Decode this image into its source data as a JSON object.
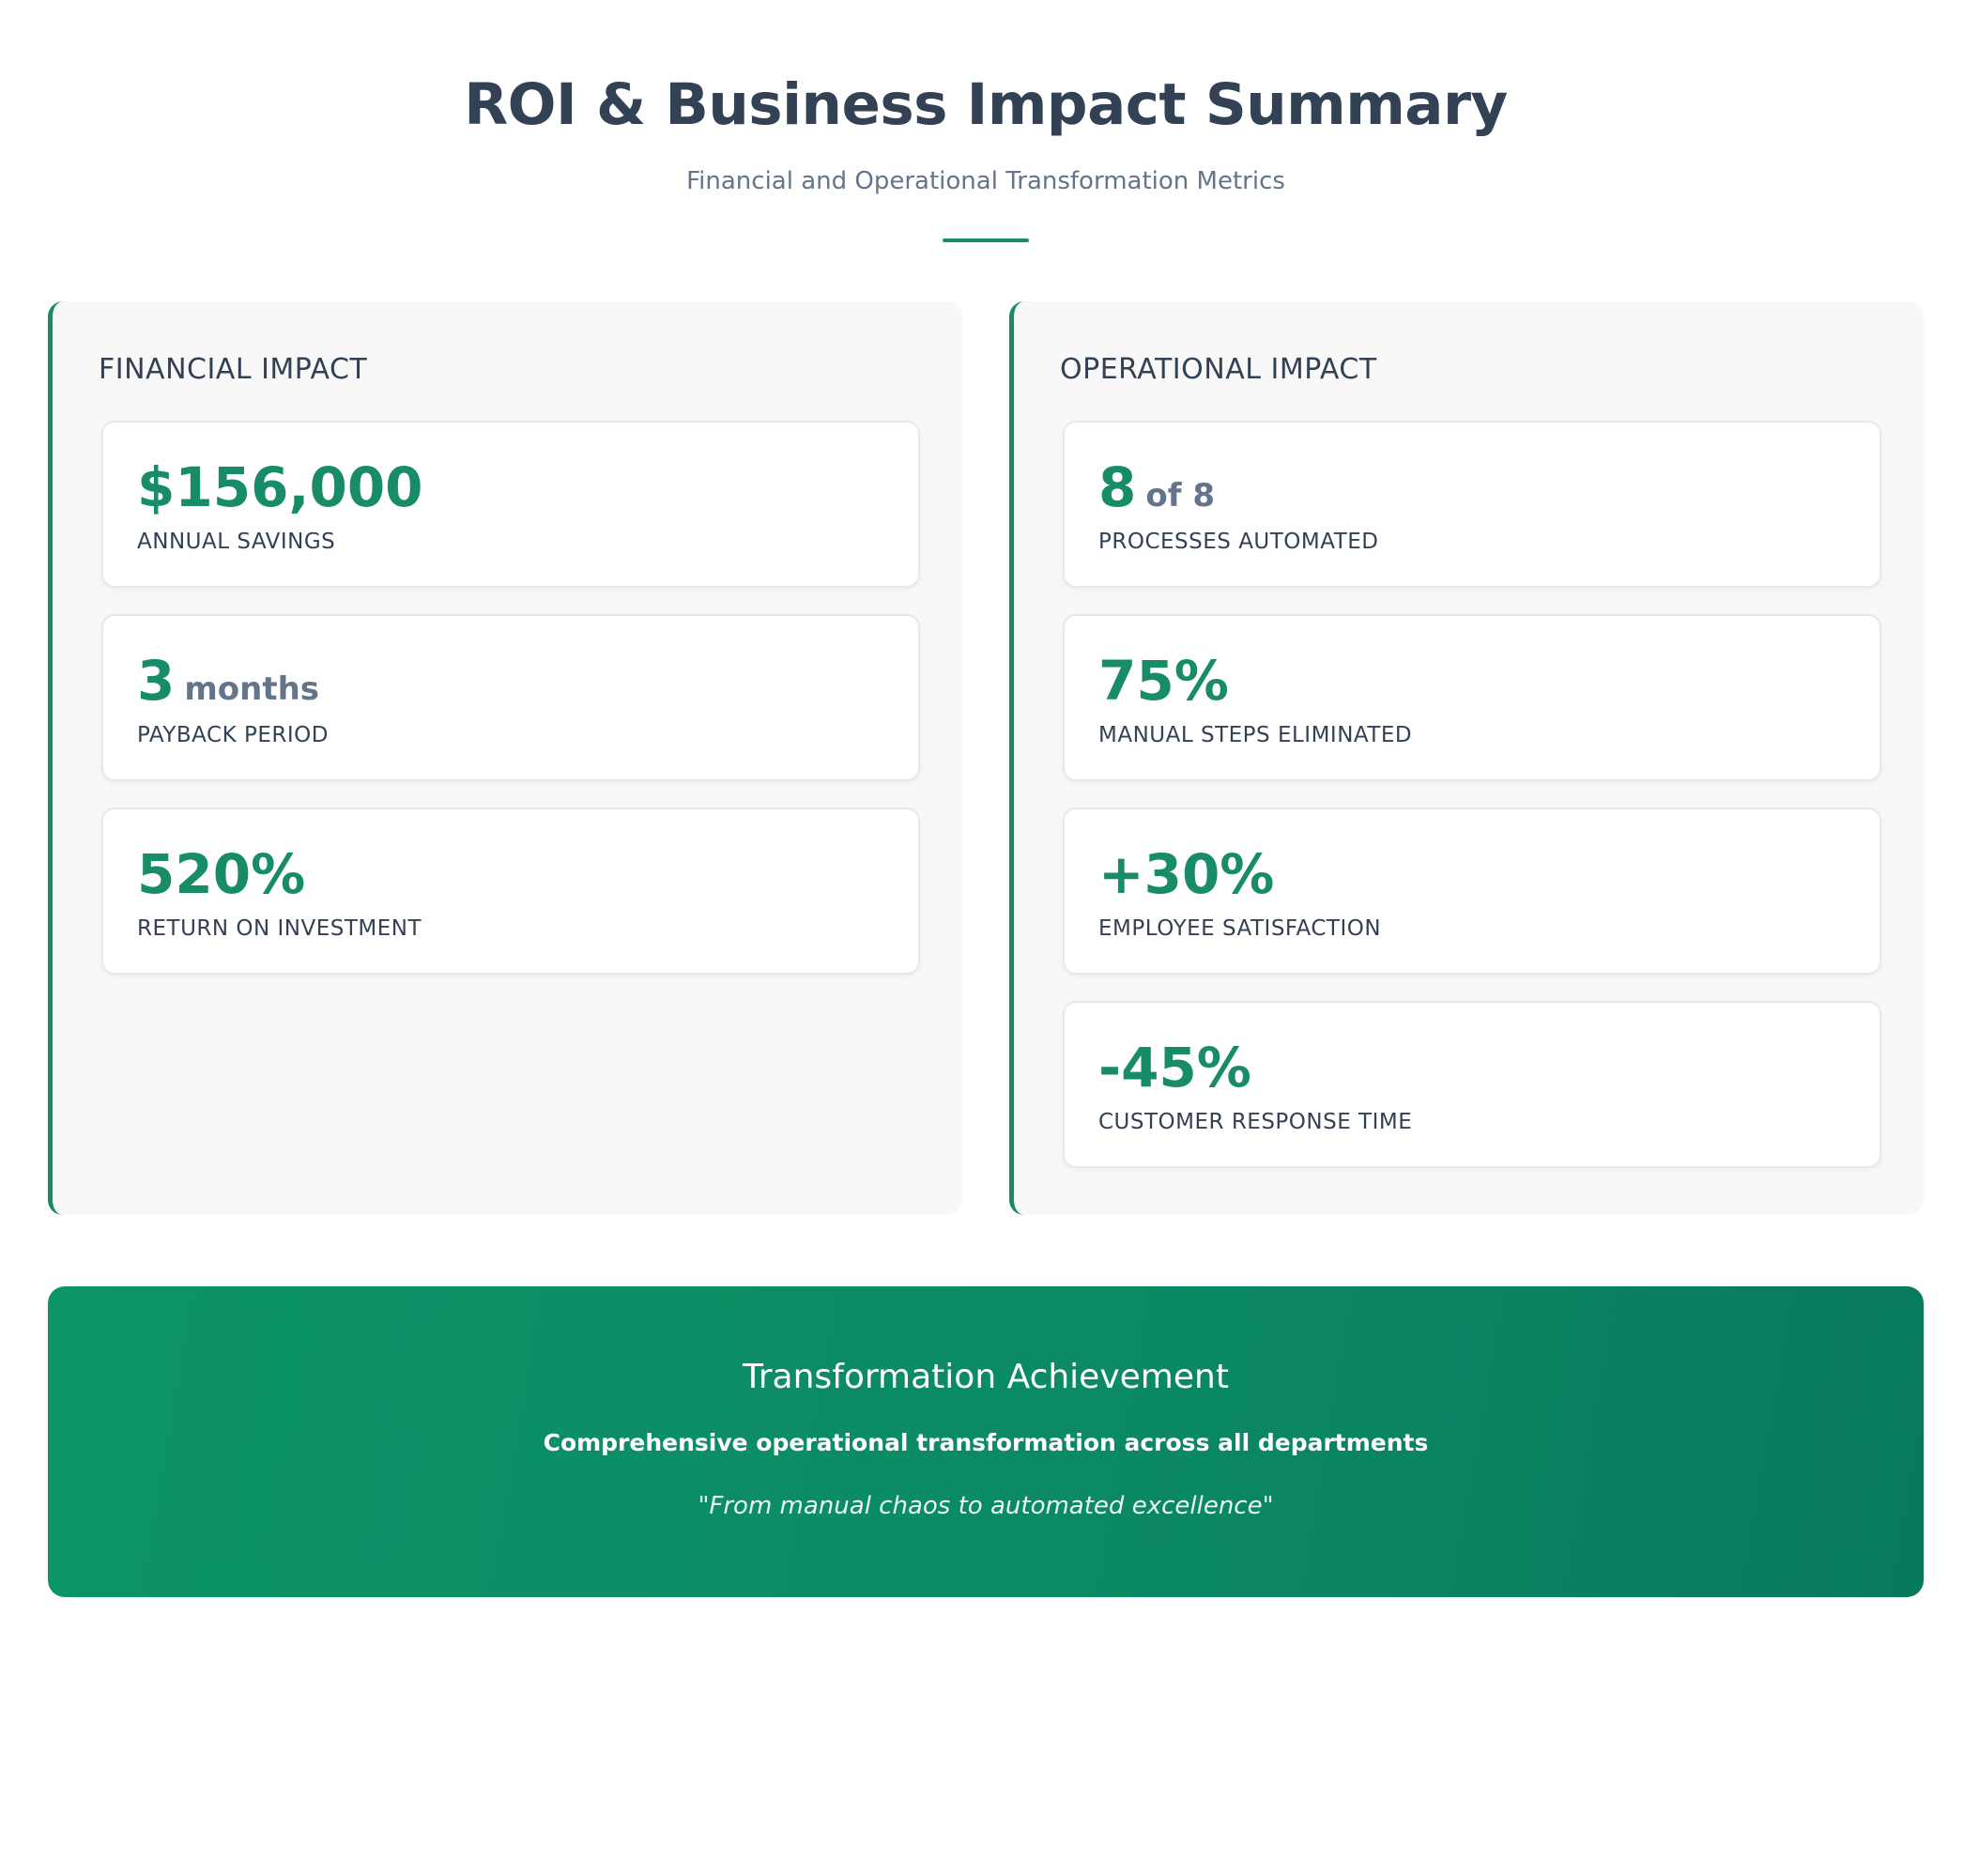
{
  "header": {
    "title": "ROI & Business Impact Summary",
    "subtitle": "Financial and Operational Transformation Metrics"
  },
  "financial": {
    "title": "FINANCIAL IMPACT",
    "cards": [
      {
        "value": "$156,000",
        "unit": "",
        "label": "ANNUAL SAVINGS"
      },
      {
        "value": "3",
        "unit": "months",
        "label": "PAYBACK PERIOD"
      },
      {
        "value": "520%",
        "unit": "",
        "label": "RETURN ON INVESTMENT"
      }
    ]
  },
  "operational": {
    "title": "OPERATIONAL IMPACT",
    "cards": [
      {
        "value": "8",
        "unit": "of 8",
        "label": "PROCESSES AUTOMATED"
      },
      {
        "value": "75%",
        "unit": "",
        "label": "MANUAL STEPS ELIMINATED"
      },
      {
        "value": "+30%",
        "unit": "",
        "label": "EMPLOYEE SATISFACTION"
      },
      {
        "value": "-45%",
        "unit": "",
        "label": "CUSTOMER RESPONSE TIME"
      }
    ]
  },
  "achievement": {
    "title": "Transformation Achievement",
    "text": "Comprehensive operational transformation across all departments",
    "quote": "\"From manual chaos to automated excellence\""
  },
  "colors": {
    "accent": "#188b68",
    "heading": "#334155",
    "muted": "#64748b",
    "panel_bg": "#f8f8f8"
  }
}
